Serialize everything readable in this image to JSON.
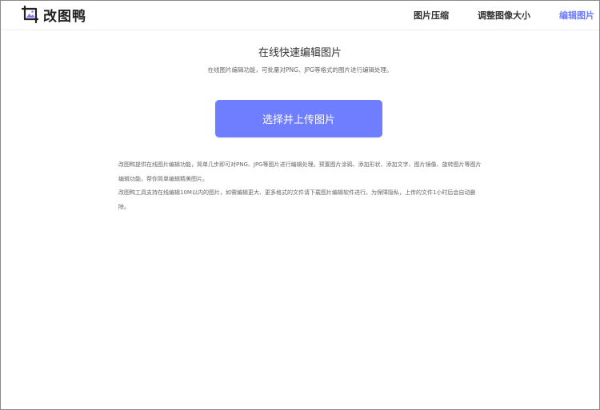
{
  "header": {
    "logo_text": "改图鸭",
    "logo_icon": "image-crop-icon",
    "nav": [
      {
        "label": "图片压缩",
        "active": false
      },
      {
        "label": "调整图像大小",
        "active": false
      },
      {
        "label": "编辑图片",
        "active": true
      }
    ]
  },
  "main": {
    "title": "在线快速编辑图片",
    "subtitle": "在线图片编辑功能，可批量对PNG、JPG等格式的图片进行编辑处理。",
    "upload_button": "选择并上传图片",
    "description": [
      "改图鸭提供在线图片编辑功能，简单几步即可对PNG、JPG等图片进行编辑处理。预置图片涂鸦、添加形状、添加文字、图片镜像、旋转图片等图片编辑功能，帮你简单编辑精美图片。",
      "改图鸭工具支持在线编辑10M以内的图片，如需编辑更大、更多格式的文件请下载图片编辑软件进行。为保障隐私，上传的文件1小时后会自动删除。"
    ]
  },
  "colors": {
    "accent": "#6f7dff",
    "active_nav": "#6d7cff",
    "text_primary": "#333333",
    "text_secondary": "#666666"
  }
}
